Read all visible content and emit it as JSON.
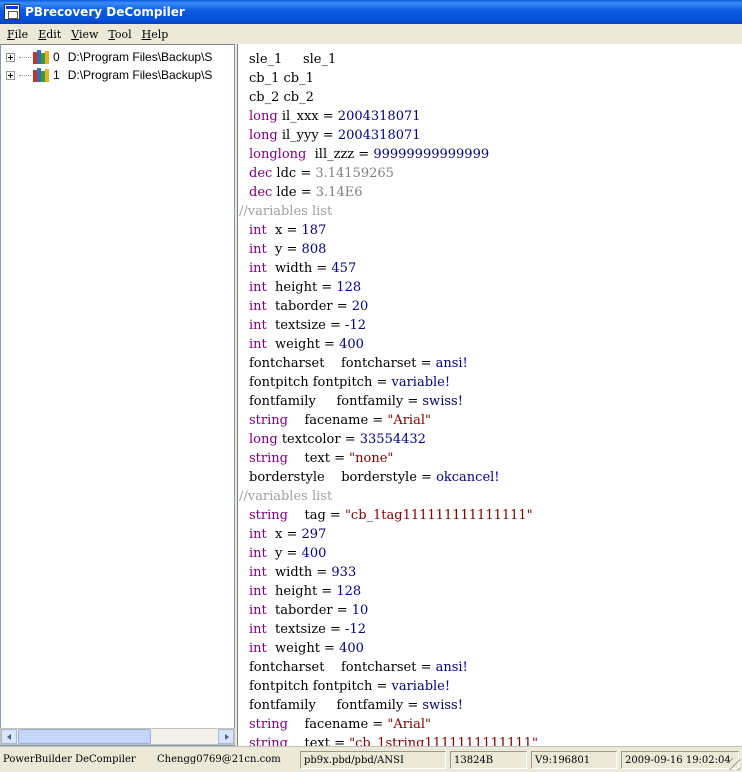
{
  "window": {
    "title": "PBrecovery DeCompiler"
  },
  "menu": [
    {
      "accel": "F",
      "rest": "ile"
    },
    {
      "accel": "E",
      "rest": "dit"
    },
    {
      "accel": "V",
      "rest": "iew"
    },
    {
      "accel": "T",
      "rest": "ool"
    },
    {
      "accel": "H",
      "rest": "elp"
    }
  ],
  "tree": [
    {
      "index": "0",
      "path": "D:\\Program Files\\Backup\\S"
    },
    {
      "index": "1",
      "path": "D:\\Program Files\\Backup\\S"
    }
  ],
  "code_lines": [
    [
      {
        "t": "sle_1     sle_1",
        "c": ""
      }
    ],
    [
      {
        "t": "cb_1 cb_1",
        "c": ""
      }
    ],
    [
      {
        "t": "cb_2 cb_2",
        "c": ""
      }
    ],
    [
      {
        "t": "long",
        "c": "kw"
      },
      {
        "t": " il_xxx = ",
        "c": ""
      },
      {
        "t": "2004318071",
        "c": "num"
      }
    ],
    [
      {
        "t": "long",
        "c": "kw"
      },
      {
        "t": " il_yyy = ",
        "c": ""
      },
      {
        "t": "2004318071",
        "c": "num"
      }
    ],
    [
      {
        "t": "longlong",
        "c": "kw"
      },
      {
        "t": "  ill_zzz = ",
        "c": ""
      },
      {
        "t": "99999999999999",
        "c": "num"
      }
    ],
    [
      {
        "t": "dec",
        "c": "kw"
      },
      {
        "t": " ldc = ",
        "c": ""
      },
      {
        "t": "3.14159265",
        "c": "gray"
      }
    ],
    [
      {
        "t": "dec",
        "c": "kw"
      },
      {
        "t": " lde = ",
        "c": ""
      },
      {
        "t": "3.14E6",
        "c": "gray"
      }
    ],
    [
      {
        "t": "//variables list",
        "c": "cmt"
      }
    ],
    [
      {
        "t": "int",
        "c": "kw"
      },
      {
        "t": "  x = ",
        "c": ""
      },
      {
        "t": "187",
        "c": "num"
      }
    ],
    [
      {
        "t": "int",
        "c": "kw"
      },
      {
        "t": "  y = ",
        "c": ""
      },
      {
        "t": "808",
        "c": "num"
      }
    ],
    [
      {
        "t": "int",
        "c": "kw"
      },
      {
        "t": "  width = ",
        "c": ""
      },
      {
        "t": "457",
        "c": "num"
      }
    ],
    [
      {
        "t": "int",
        "c": "kw"
      },
      {
        "t": "  height = ",
        "c": ""
      },
      {
        "t": "128",
        "c": "num"
      }
    ],
    [
      {
        "t": "int",
        "c": "kw"
      },
      {
        "t": "  taborder = ",
        "c": ""
      },
      {
        "t": "20",
        "c": "num"
      }
    ],
    [
      {
        "t": "int",
        "c": "kw"
      },
      {
        "t": "  textsize = ",
        "c": ""
      },
      {
        "t": "-12",
        "c": "num"
      }
    ],
    [
      {
        "t": "int",
        "c": "kw"
      },
      {
        "t": "  weight = ",
        "c": ""
      },
      {
        "t": "400",
        "c": "num"
      }
    ],
    [
      {
        "t": "fontcharset    fontcharset = ",
        "c": ""
      },
      {
        "t": "ansi!",
        "c": "num"
      }
    ],
    [
      {
        "t": "fontpitch fontpitch = ",
        "c": ""
      },
      {
        "t": "variable!",
        "c": "num"
      }
    ],
    [
      {
        "t": "fontfamily     fontfamily = ",
        "c": ""
      },
      {
        "t": "swiss!",
        "c": "num"
      }
    ],
    [
      {
        "t": "string",
        "c": "kw"
      },
      {
        "t": "    facename = ",
        "c": ""
      },
      {
        "t": "\"Arial\"",
        "c": "str"
      }
    ],
    [
      {
        "t": "long",
        "c": "kw"
      },
      {
        "t": " textcolor = ",
        "c": ""
      },
      {
        "t": "33554432",
        "c": "num"
      }
    ],
    [
      {
        "t": "string",
        "c": "kw"
      },
      {
        "t": "    text = ",
        "c": ""
      },
      {
        "t": "\"none\"",
        "c": "str"
      }
    ],
    [
      {
        "t": "borderstyle    borderstyle = ",
        "c": ""
      },
      {
        "t": "okcancel!",
        "c": "num"
      }
    ],
    [
      {
        "t": "//variables list",
        "c": "cmt"
      }
    ],
    [
      {
        "t": "string",
        "c": "kw"
      },
      {
        "t": "    tag = ",
        "c": ""
      },
      {
        "t": "\"cb_1tag111111111111111\"",
        "c": "str"
      }
    ],
    [
      {
        "t": "int",
        "c": "kw"
      },
      {
        "t": "  x = ",
        "c": ""
      },
      {
        "t": "297",
        "c": "num"
      }
    ],
    [
      {
        "t": "int",
        "c": "kw"
      },
      {
        "t": "  y = ",
        "c": ""
      },
      {
        "t": "400",
        "c": "num"
      }
    ],
    [
      {
        "t": "int",
        "c": "kw"
      },
      {
        "t": "  width = ",
        "c": ""
      },
      {
        "t": "933",
        "c": "num"
      }
    ],
    [
      {
        "t": "int",
        "c": "kw"
      },
      {
        "t": "  height = ",
        "c": ""
      },
      {
        "t": "128",
        "c": "num"
      }
    ],
    [
      {
        "t": "int",
        "c": "kw"
      },
      {
        "t": "  taborder = ",
        "c": ""
      },
      {
        "t": "10",
        "c": "num"
      }
    ],
    [
      {
        "t": "int",
        "c": "kw"
      },
      {
        "t": "  textsize = ",
        "c": ""
      },
      {
        "t": "-12",
        "c": "num"
      }
    ],
    [
      {
        "t": "int",
        "c": "kw"
      },
      {
        "t": "  weight = ",
        "c": ""
      },
      {
        "t": "400",
        "c": "num"
      }
    ],
    [
      {
        "t": "fontcharset    fontcharset = ",
        "c": ""
      },
      {
        "t": "ansi!",
        "c": "num"
      }
    ],
    [
      {
        "t": "fontpitch fontpitch = ",
        "c": ""
      },
      {
        "t": "variable!",
        "c": "num"
      }
    ],
    [
      {
        "t": "fontfamily     fontfamily = ",
        "c": ""
      },
      {
        "t": "swiss!",
        "c": "num"
      }
    ],
    [
      {
        "t": "string",
        "c": "kw"
      },
      {
        "t": "    facename = ",
        "c": ""
      },
      {
        "t": "\"Arial\"",
        "c": "str"
      }
    ],
    [
      {
        "t": "string",
        "c": "kw"
      },
      {
        "t": "    text = ",
        "c": ""
      },
      {
        "t": "\"cb_1string1111111111111\"",
        "c": "str"
      }
    ]
  ],
  "status": {
    "app": "PowerBuilder DeCompiler",
    "email": "Chengg0769@21cn.com",
    "path": "pb9x.pbd/pbd/ANSI",
    "size": "13824B",
    "version": "V9:196801",
    "datetime": "2009-09-16 19:02:04"
  },
  "colors": {
    "keyword": "#800080",
    "number": "#000080",
    "string": "#800000",
    "comment": "#a0a0a0",
    "decimal": "#808080"
  }
}
